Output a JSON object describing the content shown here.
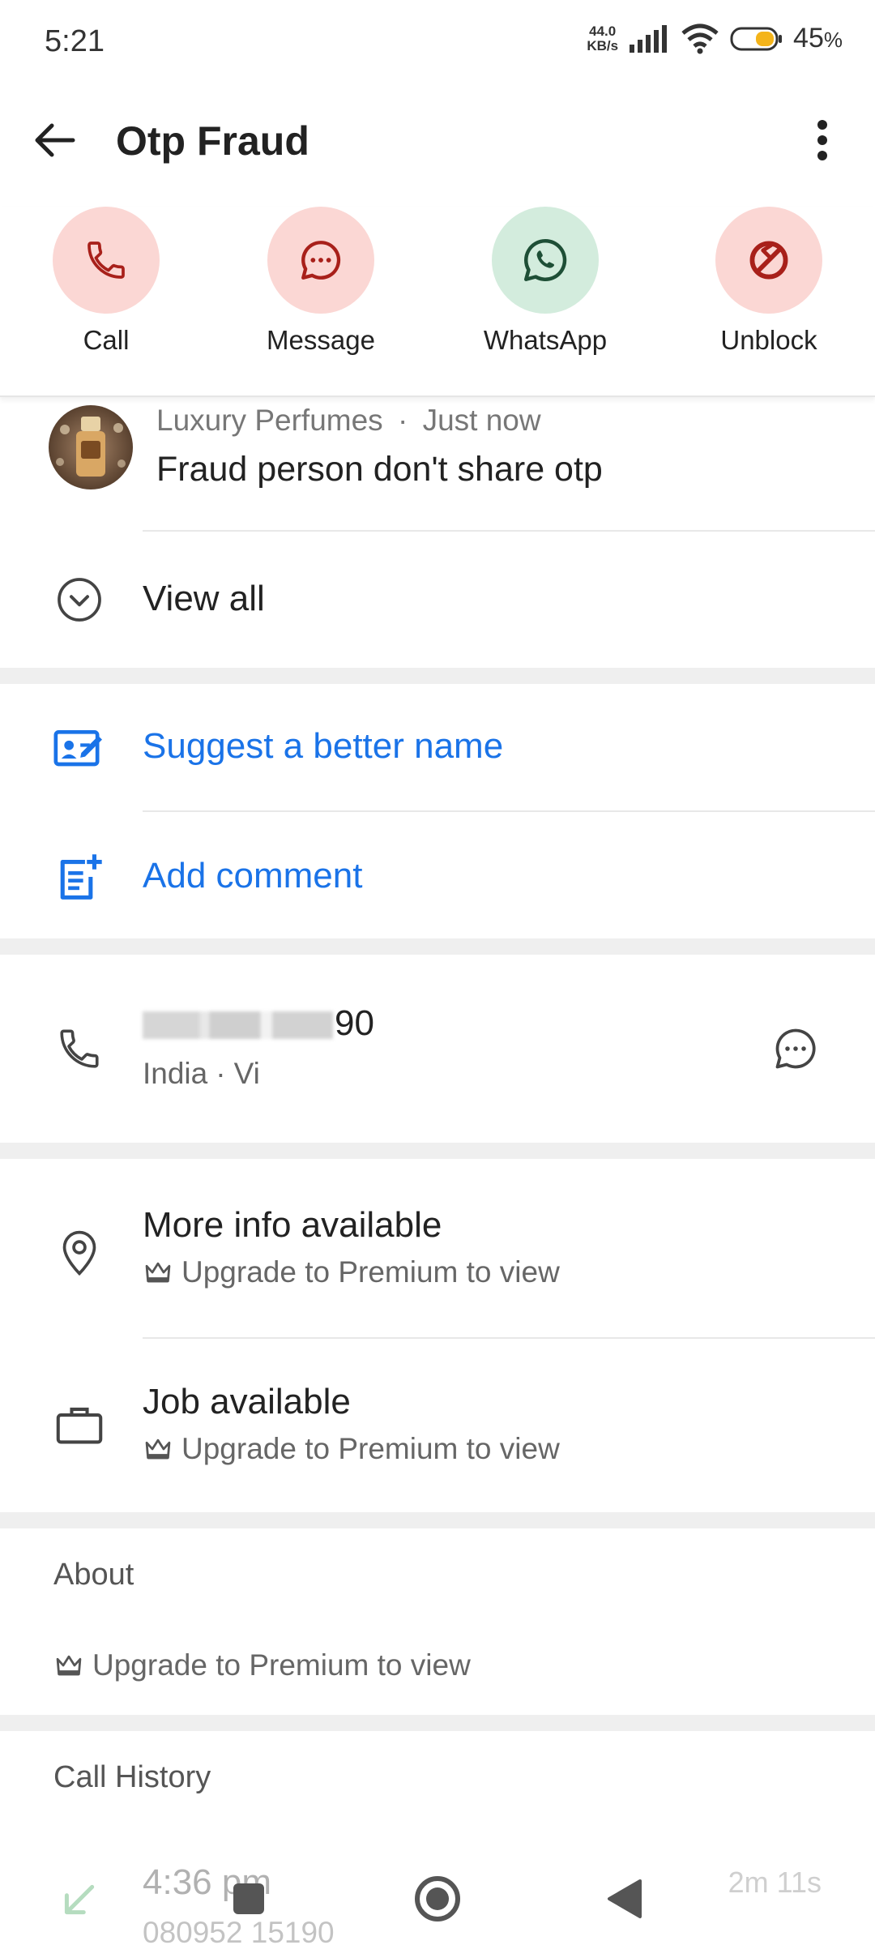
{
  "status_bar": {
    "time": "5:21",
    "net_speed_value": "44.0",
    "net_speed_unit": "KB/s",
    "battery_percent": "45",
    "battery_unit": "%"
  },
  "header": {
    "title": "Otp Fraud"
  },
  "actions": [
    {
      "label": "Call",
      "icon": "phone-icon",
      "bg": "#fbd7d4",
      "fg": "#a8201a"
    },
    {
      "label": "Message",
      "icon": "message-icon",
      "bg": "#fbd7d4",
      "fg": "#a8201a"
    },
    {
      "label": "WhatsApp",
      "icon": "whatsapp-icon",
      "bg": "#d3ecdd",
      "fg": "#1e4f36"
    },
    {
      "label": "Unblock",
      "icon": "unblock-icon",
      "bg": "#fbd7d4",
      "fg": "#a8201a"
    }
  ],
  "comment": {
    "author": "Luxury Perfumes",
    "time": "Just now",
    "separator": "·",
    "text": "Fraud person don't share otp"
  },
  "view_all": {
    "label": "View all"
  },
  "suggest": {
    "label": "Suggest a better name"
  },
  "add_comment": {
    "label": "Add comment"
  },
  "phone": {
    "number_visible_suffix": "90",
    "country": "India",
    "separator": "·",
    "carrier": "Vi"
  },
  "more_info": {
    "title": "More info available",
    "upgrade": "Upgrade to Premium to view"
  },
  "job": {
    "title": "Job available",
    "upgrade": "Upgrade to Premium to view"
  },
  "about": {
    "heading": "About",
    "upgrade": "Upgrade to Premium to view"
  },
  "call_history": {
    "heading": "Call History",
    "entry_time": "4:36 pm",
    "entry_number": "080952 15190",
    "entry_duration": "2m 11s"
  },
  "colors": {
    "accent": "#1a73e8",
    "danger_bg": "#fbd7d4",
    "danger_fg": "#a8201a",
    "whatsapp_bg": "#d3ecdd",
    "whatsapp_fg": "#1e4f36"
  }
}
